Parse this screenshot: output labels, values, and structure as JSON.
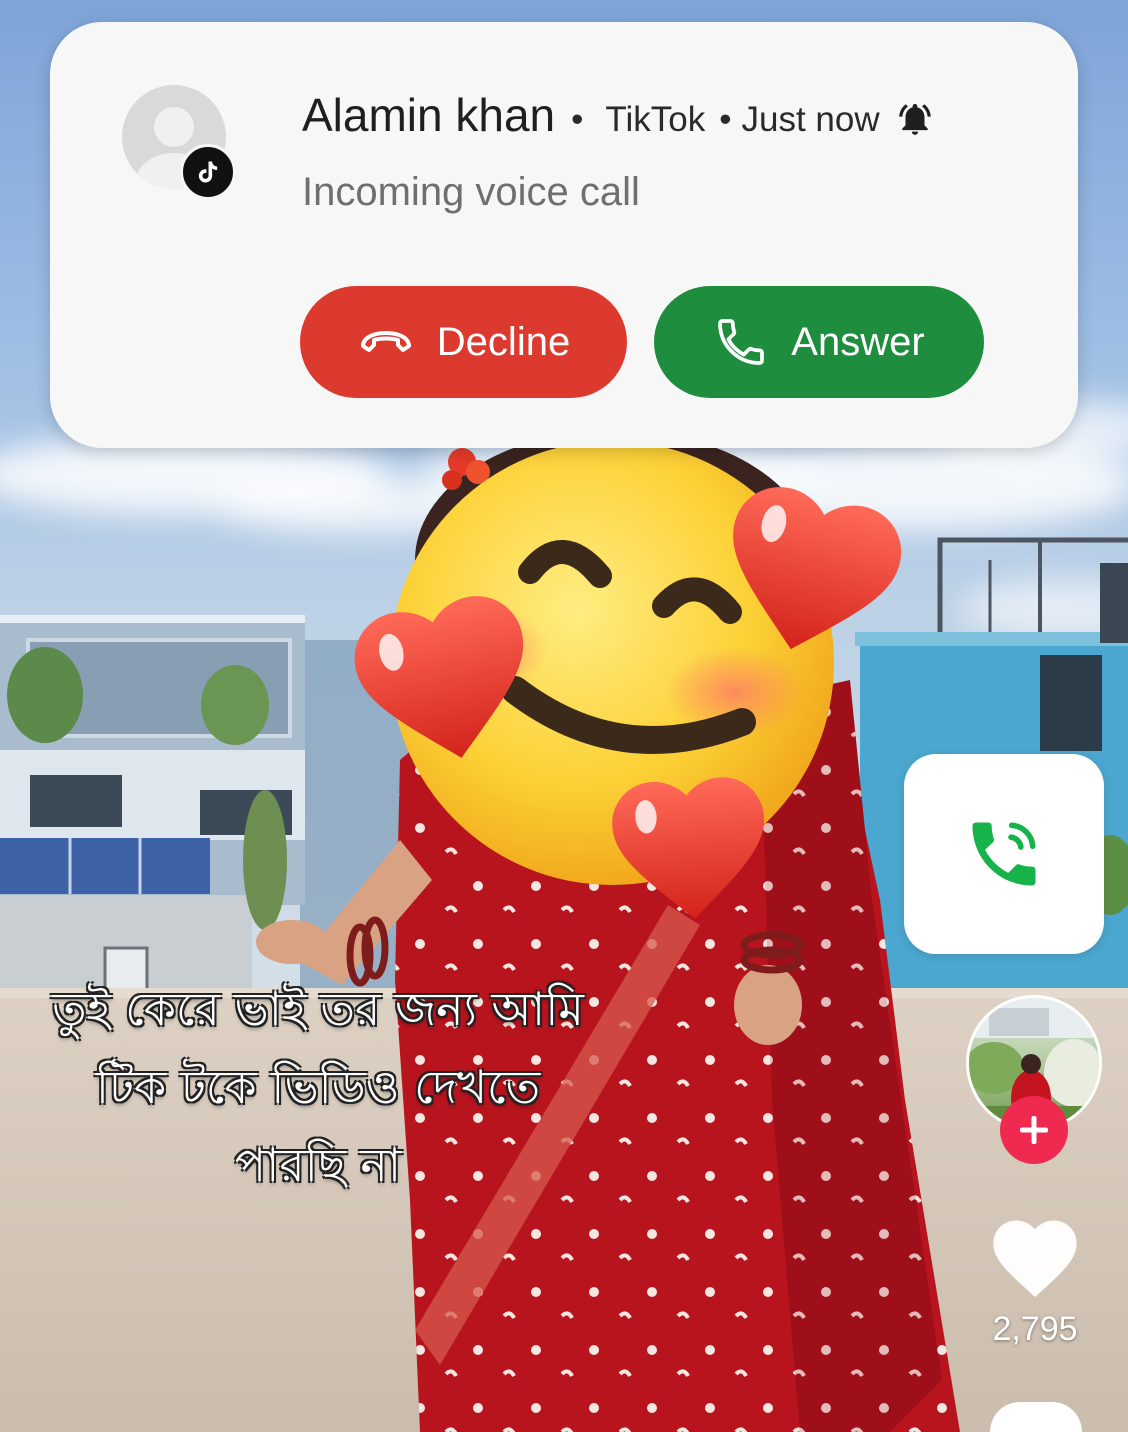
{
  "notification": {
    "avatar_icon": "person-placeholder-icon",
    "app_badge_icon": "tiktok-logo-icon",
    "caller_name": "Alamin khan",
    "separator": "•",
    "app_name": "TikTok",
    "time": "Just now",
    "alert_icon": "bell-ringing-icon",
    "subtitle": "Incoming voice call",
    "decline": {
      "label": "Decline",
      "icon": "call-end-icon",
      "color": "#dc3a2e"
    },
    "answer": {
      "label": "Answer",
      "icon": "phone-icon",
      "color": "#1e8d3e"
    }
  },
  "floating_call": {
    "icon": "phone-calling-icon",
    "color": "#16b34a"
  },
  "video": {
    "sticker": "smiling-face-with-hearts-emoji",
    "caption_lines": [
      "তুই কেরে ভাই তর জন্য আমি",
      "টিক টকে ভিডিও দেখতে",
      "পারছি না"
    ]
  },
  "sidebar": {
    "creator_avatar": "creator-avatar",
    "follow_icon": "plus-icon",
    "like_icon": "heart-icon",
    "like_count": "2,795",
    "next_icon": "comment-icon"
  },
  "colors": {
    "card_background": "#f7f7f7",
    "follow_button": "#ef2950",
    "caption_text": "#ffffff"
  }
}
